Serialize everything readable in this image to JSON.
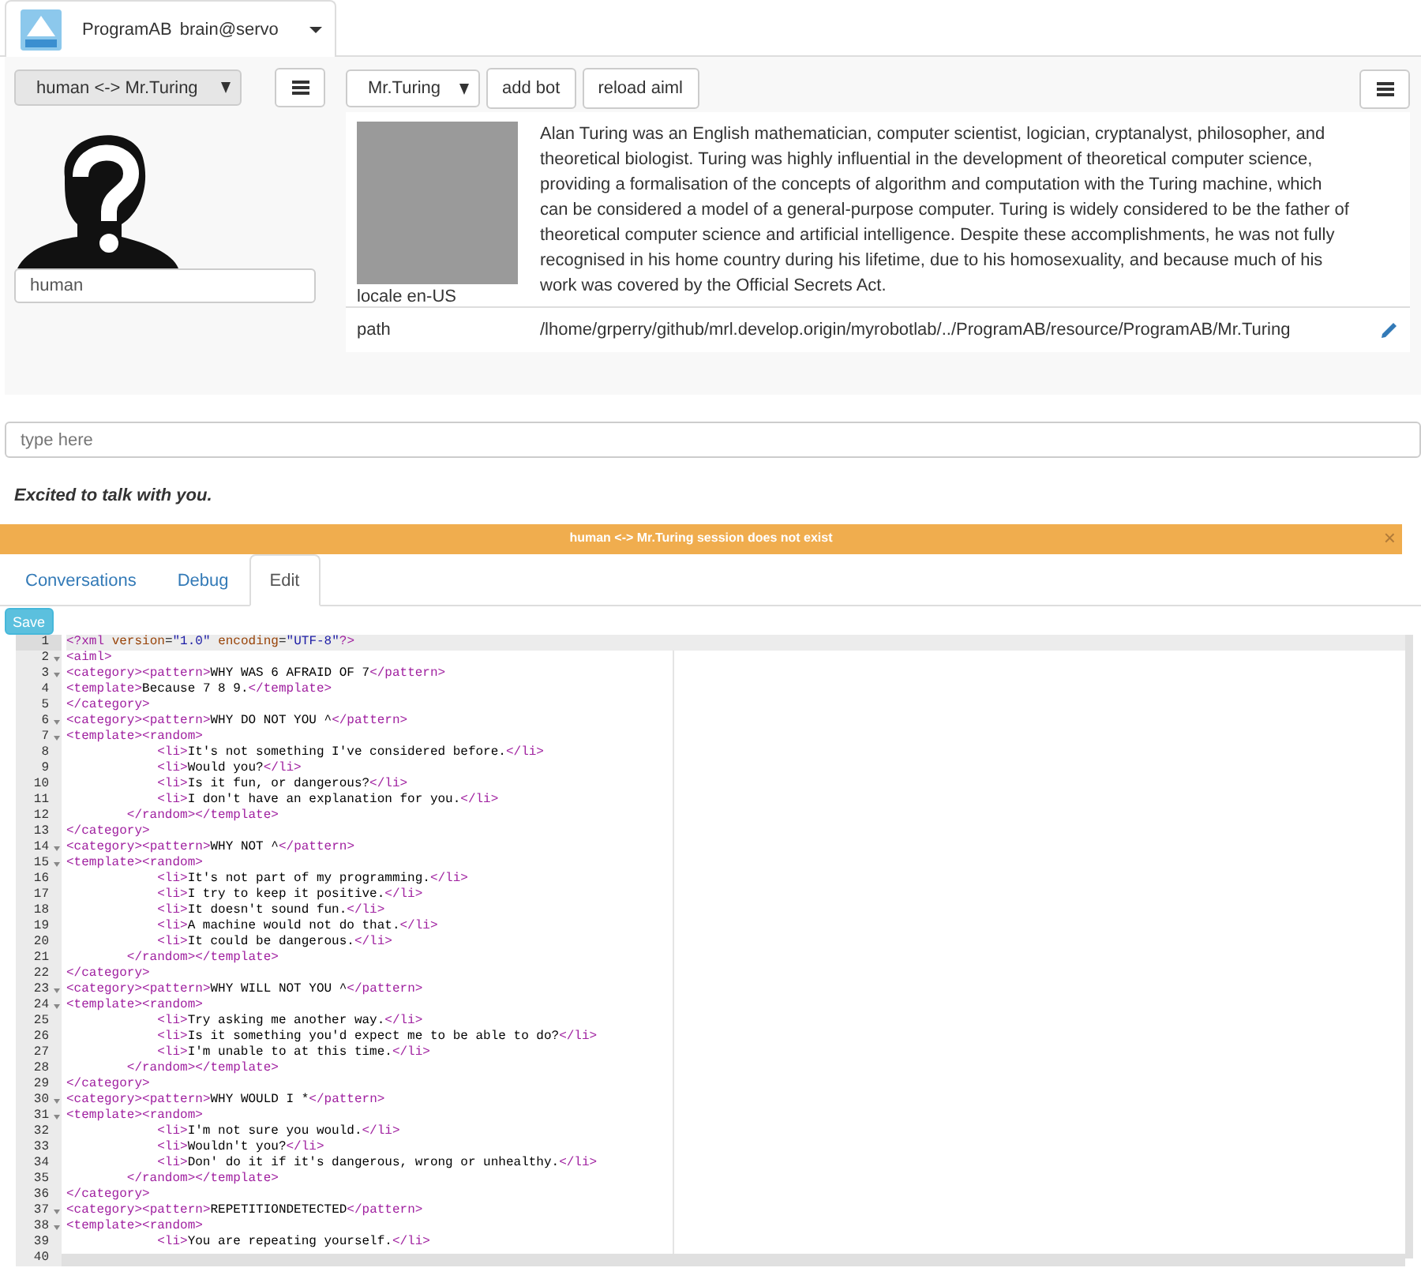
{
  "app_tab": {
    "title": "ProgramAB",
    "name": "brain@servo"
  },
  "session_select": {
    "value": "human <-> Mr.Turing"
  },
  "user_name_field": {
    "value": "human"
  },
  "bot_select": {
    "value": "Mr.Turing"
  },
  "bot_buttons": [
    "add bot",
    "reload aiml"
  ],
  "bot_info": {
    "photo_caption": "locale en-US",
    "description": "Alan Turing was an English mathematician, computer scientist, logician, cryptanalyst, philosopher, and theoretical biologist. Turing was highly influential in the development of theoretical computer science, providing a formalisation of the concepts of algorithm and computation with the Turing machine, which can be considered a model of a general-purpose computer. Turing is widely considered to be the father of theoretical computer science and artificial intelligence. Despite these accomplishments, he was not fully recognised in his home country during his lifetime, due to his homosexuality, and because much of his work was covered by the Official Secrets Act.",
    "path_label": "path",
    "path": "/lhome/grperry/github/mrl.develop.origin/myrobotlab/../ProgramAB/resource/ProgramAB/Mr.Turing"
  },
  "chat_input": {
    "placeholder": "type here"
  },
  "response": "Excited to talk with you.",
  "alert": {
    "message": "human <-> Mr.Turing session does not exist",
    "close": "×"
  },
  "tabs": [
    {
      "label": "Conversations",
      "selected": false
    },
    {
      "label": "Debug",
      "selected": false
    },
    {
      "label": "Edit",
      "selected": true
    }
  ],
  "editor": {
    "save": "Save",
    "lines": [
      {
        "number": "1",
        "code": "<?xml version=\"1.0\" encoding=\"UTF-8\"?>",
        "foldable": false,
        "active": true
      },
      {
        "number": "2",
        "code": "<aiml>",
        "foldable": true,
        "active": false
      },
      {
        "number": "3",
        "code": "<category><pattern>WHY WAS 6 AFRAID OF 7</pattern>",
        "foldable": true,
        "active": false
      },
      {
        "number": "4",
        "code": "<template>Because 7 8 9.</template>",
        "foldable": false,
        "active": false
      },
      {
        "number": "5",
        "code": "</category>",
        "foldable": false,
        "active": false
      },
      {
        "number": "6",
        "code": "<category><pattern>WHY DO NOT YOU ^</pattern>",
        "foldable": true,
        "active": false
      },
      {
        "number": "7",
        "code": "<template><random>",
        "foldable": true,
        "active": false
      },
      {
        "number": "8",
        "code": "            <li>It's not something I've considered before.</li>",
        "foldable": false,
        "active": false
      },
      {
        "number": "9",
        "code": "            <li>Would you?</li>",
        "foldable": false,
        "active": false
      },
      {
        "number": "10",
        "code": "            <li>Is it fun, or dangerous?</li>",
        "foldable": false,
        "active": false
      },
      {
        "number": "11",
        "code": "            <li>I don't have an explanation for you.</li>",
        "foldable": false,
        "active": false
      },
      {
        "number": "12",
        "code": "        </random></template>",
        "foldable": false,
        "active": false
      },
      {
        "number": "13",
        "code": "</category>",
        "foldable": false,
        "active": false
      },
      {
        "number": "14",
        "code": "<category><pattern>WHY NOT ^</pattern>",
        "foldable": true,
        "active": false
      },
      {
        "number": "15",
        "code": "<template><random>",
        "foldable": true,
        "active": false
      },
      {
        "number": "16",
        "code": "            <li>It's not part of my programming.</li>",
        "foldable": false,
        "active": false
      },
      {
        "number": "17",
        "code": "            <li>I try to keep it positive.</li>",
        "foldable": false,
        "active": false
      },
      {
        "number": "18",
        "code": "            <li>It doesn't sound fun.</li>",
        "foldable": false,
        "active": false
      },
      {
        "number": "19",
        "code": "            <li>A machine would not do that.</li>",
        "foldable": false,
        "active": false
      },
      {
        "number": "20",
        "code": "            <li>It could be dangerous.</li>",
        "foldable": false,
        "active": false
      },
      {
        "number": "21",
        "code": "        </random></template>",
        "foldable": false,
        "active": false
      },
      {
        "number": "22",
        "code": "</category>",
        "foldable": false,
        "active": false
      },
      {
        "number": "23",
        "code": "<category><pattern>WHY WILL NOT YOU ^</pattern>",
        "foldable": true,
        "active": false
      },
      {
        "number": "24",
        "code": "<template><random>",
        "foldable": true,
        "active": false
      },
      {
        "number": "25",
        "code": "            <li>Try asking me another way.</li>",
        "foldable": false,
        "active": false
      },
      {
        "number": "26",
        "code": "            <li>Is it something you'd expect me to be able to do?</li>",
        "foldable": false,
        "active": false
      },
      {
        "number": "27",
        "code": "            <li>I'm unable to at this time.</li>",
        "foldable": false,
        "active": false
      },
      {
        "number": "28",
        "code": "        </random></template>",
        "foldable": false,
        "active": false
      },
      {
        "number": "29",
        "code": "</category>",
        "foldable": false,
        "active": false
      },
      {
        "number": "30",
        "code": "<category><pattern>WHY WOULD I *</pattern>",
        "foldable": true,
        "active": false
      },
      {
        "number": "31",
        "code": "<template><random>",
        "foldable": true,
        "active": false
      },
      {
        "number": "32",
        "code": "            <li>I'm not sure you would.</li>",
        "foldable": false,
        "active": false
      },
      {
        "number": "33",
        "code": "            <li>Wouldn't you?</li>",
        "foldable": false,
        "active": false
      },
      {
        "number": "34",
        "code": "            <li>Don' do it if it's dangerous, wrong or unhealthy.</li>",
        "foldable": false,
        "active": false
      },
      {
        "number": "35",
        "code": "        </random></template>",
        "foldable": false,
        "active": false
      },
      {
        "number": "36",
        "code": "</category>",
        "foldable": false,
        "active": false
      },
      {
        "number": "37",
        "code": "<category><pattern>REPETITIONDETECTED</pattern>",
        "foldable": true,
        "active": false
      },
      {
        "number": "38",
        "code": "<template><random>",
        "foldable": true,
        "active": false
      },
      {
        "number": "39",
        "code": "            <li>You are repeating yourself.</li>",
        "foldable": false,
        "active": false
      },
      {
        "number": "40",
        "foldable": false,
        "active": false
      }
    ]
  }
}
